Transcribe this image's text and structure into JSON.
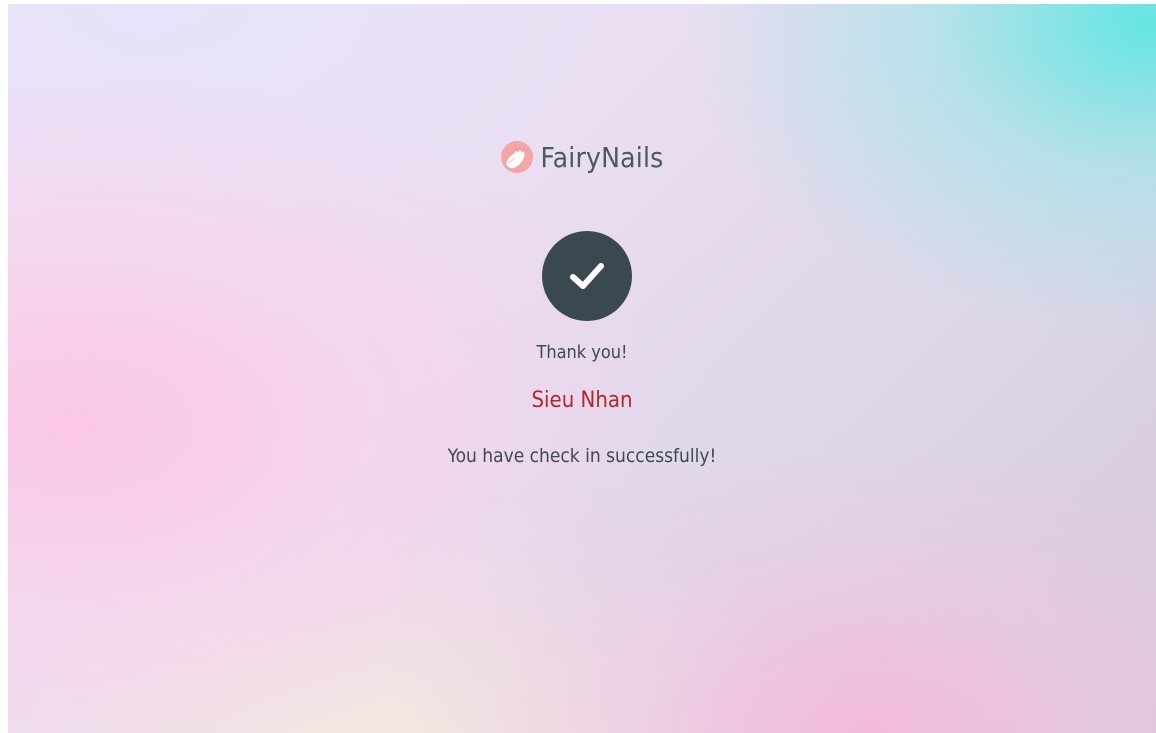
{
  "brand": {
    "name": "FairyNails",
    "logo_icon": "nail-polish-hand-icon"
  },
  "status": {
    "icon": "checkmark-icon",
    "thank_you": "Thank you!",
    "customer_name": "Sieu Nhan",
    "message": "You have check in successfully!"
  },
  "colors": {
    "check_circle": "#3a4950",
    "customer_name": "#b0272c",
    "brand_text": "#4a5964",
    "body_text": "#3e4850"
  }
}
